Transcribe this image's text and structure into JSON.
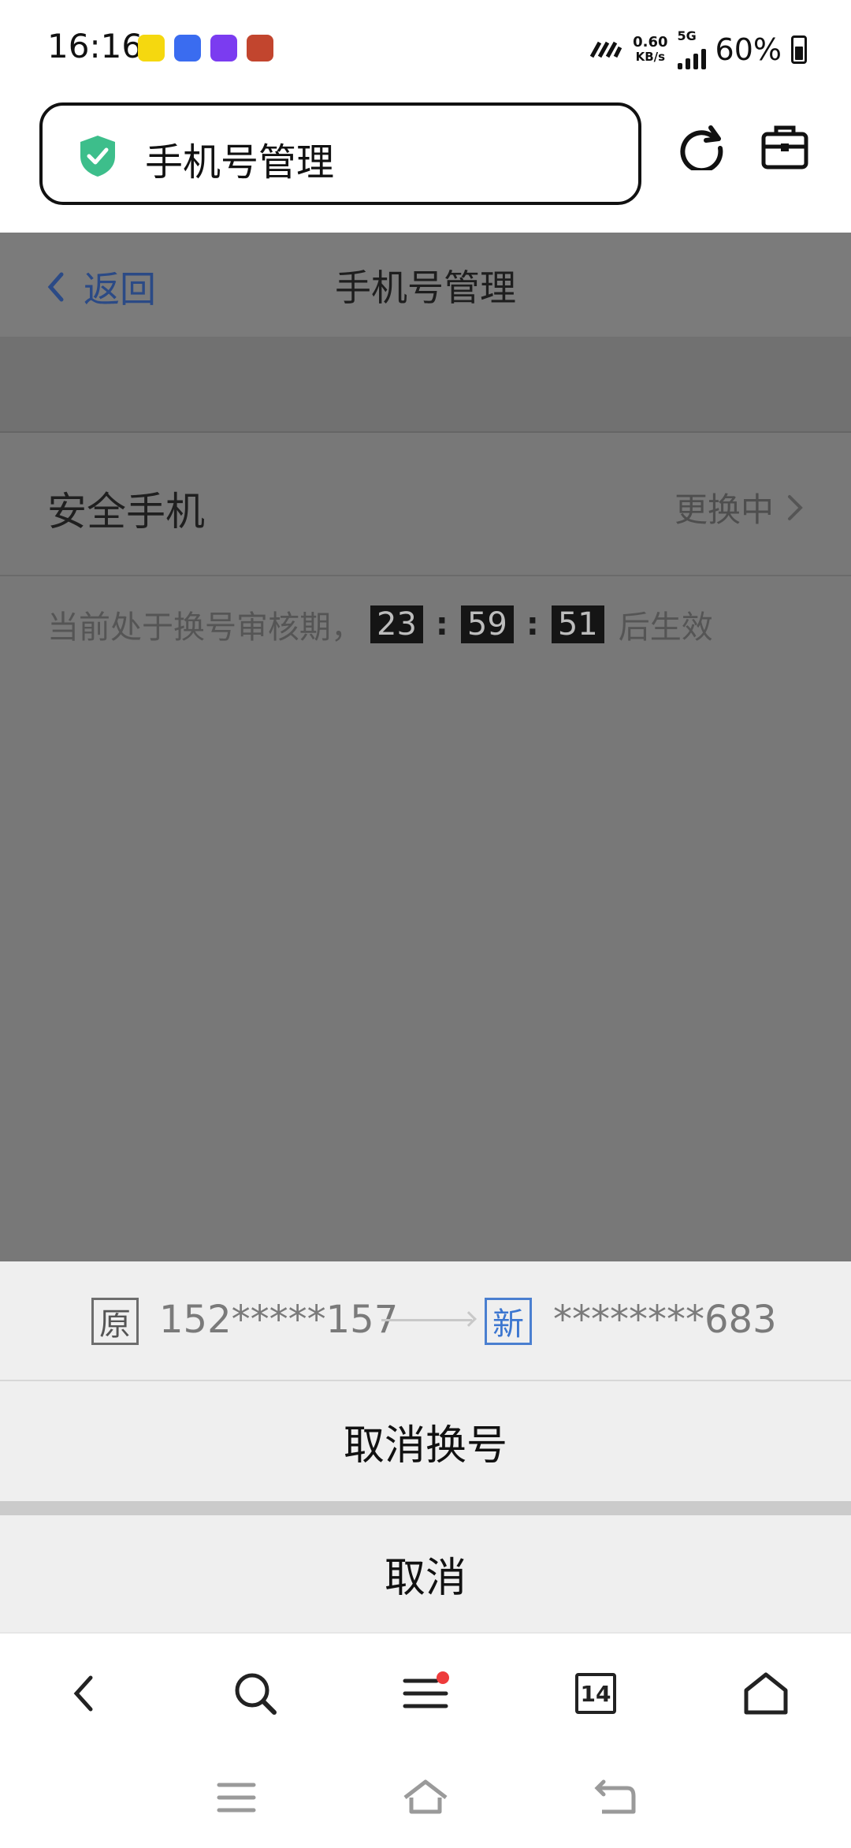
{
  "status_bar": {
    "time": "16:16",
    "app_icons": [
      "pet-app-icon",
      "vivo-app-icon",
      "purple-app-icon",
      "game-app-icon"
    ],
    "net_speed_value": "0.60",
    "net_speed_unit": "KB/s",
    "network": "5G",
    "battery": "60%"
  },
  "browser": {
    "url_title": "手机号管理"
  },
  "page": {
    "back_label": "返回",
    "title": "手机号管理",
    "row_label": "安全手机",
    "row_status": "更换中",
    "notice_prefix": "当前处于换号审核期，",
    "timer_hours": "23",
    "timer_minutes": "59",
    "timer_seconds": "51",
    "timer_separator": ":",
    "notice_suffix": "后生效"
  },
  "sheet": {
    "old_tag": "原",
    "old_number": "152*****157",
    "new_tag": "新",
    "new_number": "********683",
    "cancel_change_label": "取消换号",
    "cancel_label": "取消"
  },
  "toolbar": {
    "tabs_count": "14"
  },
  "colors": {
    "accent_blue": "#3c76d0",
    "shield_green": "#3dbe8b",
    "overlay_gray": "#787878"
  }
}
